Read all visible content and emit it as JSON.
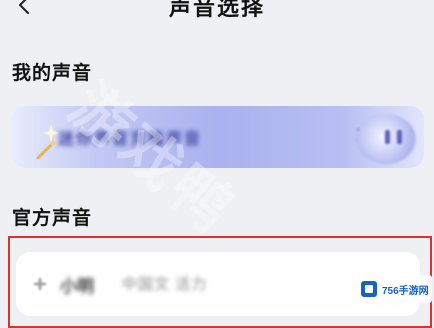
{
  "header": {
    "title": "声音选择"
  },
  "sections": {
    "my_voice": {
      "title": "我的声音",
      "banner_text": "迷你声音克隆声音"
    },
    "official": {
      "title": "官方声音",
      "first_option_name": "小明",
      "first_option_desc": "中国文 活力"
    }
  },
  "watermark": {
    "text": "游戏鸭"
  },
  "site_logo": {
    "text": "756手游网"
  },
  "colors": {
    "background": "#eef0f3",
    "banner_accent": "#aab2ef",
    "selection_border": "#e03030",
    "logo_blue": "#1565c0"
  },
  "icons": {
    "back": "chevron-left-icon",
    "sparkle": "sparkle-icon",
    "wand": "magic-wand-icon",
    "arrow": "arrow-right-icon",
    "add": "plus-icon",
    "logo": "site-logo-icon"
  }
}
